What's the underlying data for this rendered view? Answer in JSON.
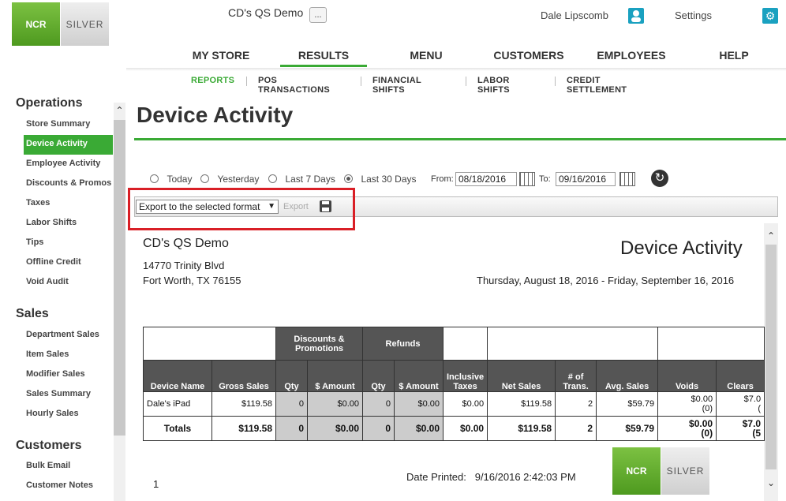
{
  "brand": {
    "ncr_logo": "NCR",
    "silver_logo": "SILVER"
  },
  "header": {
    "store_name": "CD's QS Demo",
    "more_button": "...",
    "user_name": "Dale Lipscomb",
    "settings_label": "Settings"
  },
  "topnav": {
    "items": [
      "MY STORE",
      "RESULTS",
      "MENU",
      "CUSTOMERS",
      "EMPLOYEES",
      "HELP"
    ],
    "active": "RESULTS"
  },
  "subnav": {
    "items": [
      "REPORTS",
      "POS TRANSACTIONS",
      "FINANCIAL SHIFTS",
      "LABOR SHIFTS",
      "CREDIT SETTLEMENT"
    ],
    "active": "REPORTS"
  },
  "sidebar": {
    "operations": {
      "heading": "Operations",
      "items": [
        "Store Summary",
        "Device Activity",
        "Employee Activity",
        "Discounts & Promos",
        "Taxes",
        "Labor Shifts",
        "Tips",
        "Offline Credit",
        "Void Audit"
      ],
      "active": "Device Activity"
    },
    "sales": {
      "heading": "Sales",
      "items": [
        "Department Sales",
        "Item Sales",
        "Modifier Sales",
        "Sales Summary",
        "Hourly Sales"
      ]
    },
    "customers": {
      "heading": "Customers",
      "items": [
        "Bulk Email",
        "Customer Notes"
      ]
    }
  },
  "page": {
    "title": "Device Activity"
  },
  "filters": {
    "ranges": [
      "Today",
      "Yesterday",
      "Last 7 Days",
      "Last 30 Days"
    ],
    "selected_range": "Last 30 Days",
    "from_label": "From:",
    "from_value": "08/18/2016",
    "to_label": "To:",
    "to_value": "09/16/2016"
  },
  "toolbar": {
    "export_select": "Export to the selected format",
    "export_link": "Export"
  },
  "report": {
    "store": "CD's QS Demo",
    "address1": "14770 Trinity Blvd",
    "address2": "Fort Worth, TX 76155",
    "title": "Device Activity",
    "range": "Thursday, August 18, 2016 - Friday, September 16, 2016",
    "group_headers": {
      "discounts": "Discounts & Promotions",
      "refunds": "Refunds"
    },
    "columns": [
      "Device Name",
      "Gross Sales",
      "Qty",
      "$ Amount",
      "Qty",
      "$ Amount",
      "Inclusive Taxes",
      "Net Sales",
      "# of Trans.",
      "Avg. Sales",
      "Voids",
      "Clears"
    ],
    "rows": [
      {
        "device": "Dale's iPad",
        "gross": "$119.58",
        "disc_qty": "0",
        "disc_amt": "$0.00",
        "ref_qty": "0",
        "ref_amt": "$0.00",
        "inc_tax": "$0.00",
        "net": "$119.58",
        "trans": "2",
        "avg": "$59.79",
        "voids": "$0.00",
        "voids_count": "(0)",
        "clears": "$7.0",
        "clears_count": "("
      }
    ],
    "totals": {
      "label": "Totals",
      "gross": "$119.58",
      "disc_qty": "0",
      "disc_amt": "$0.00",
      "ref_qty": "0",
      "ref_amt": "$0.00",
      "inc_tax": "$0.00",
      "net": "$119.58",
      "trans": "2",
      "avg": "$59.79",
      "voids": "$0.00",
      "voids_count": "(0)",
      "clears": "$7.0",
      "clears_count": "(5"
    },
    "page_number": "1",
    "date_printed_label": "Date Printed:",
    "date_printed_value": "9/16/2016 2:42:03 PM"
  },
  "colors": {
    "accent_green": "#3aaa35",
    "highlight_red": "#d91f26",
    "icon_teal": "#1aa1c0"
  }
}
